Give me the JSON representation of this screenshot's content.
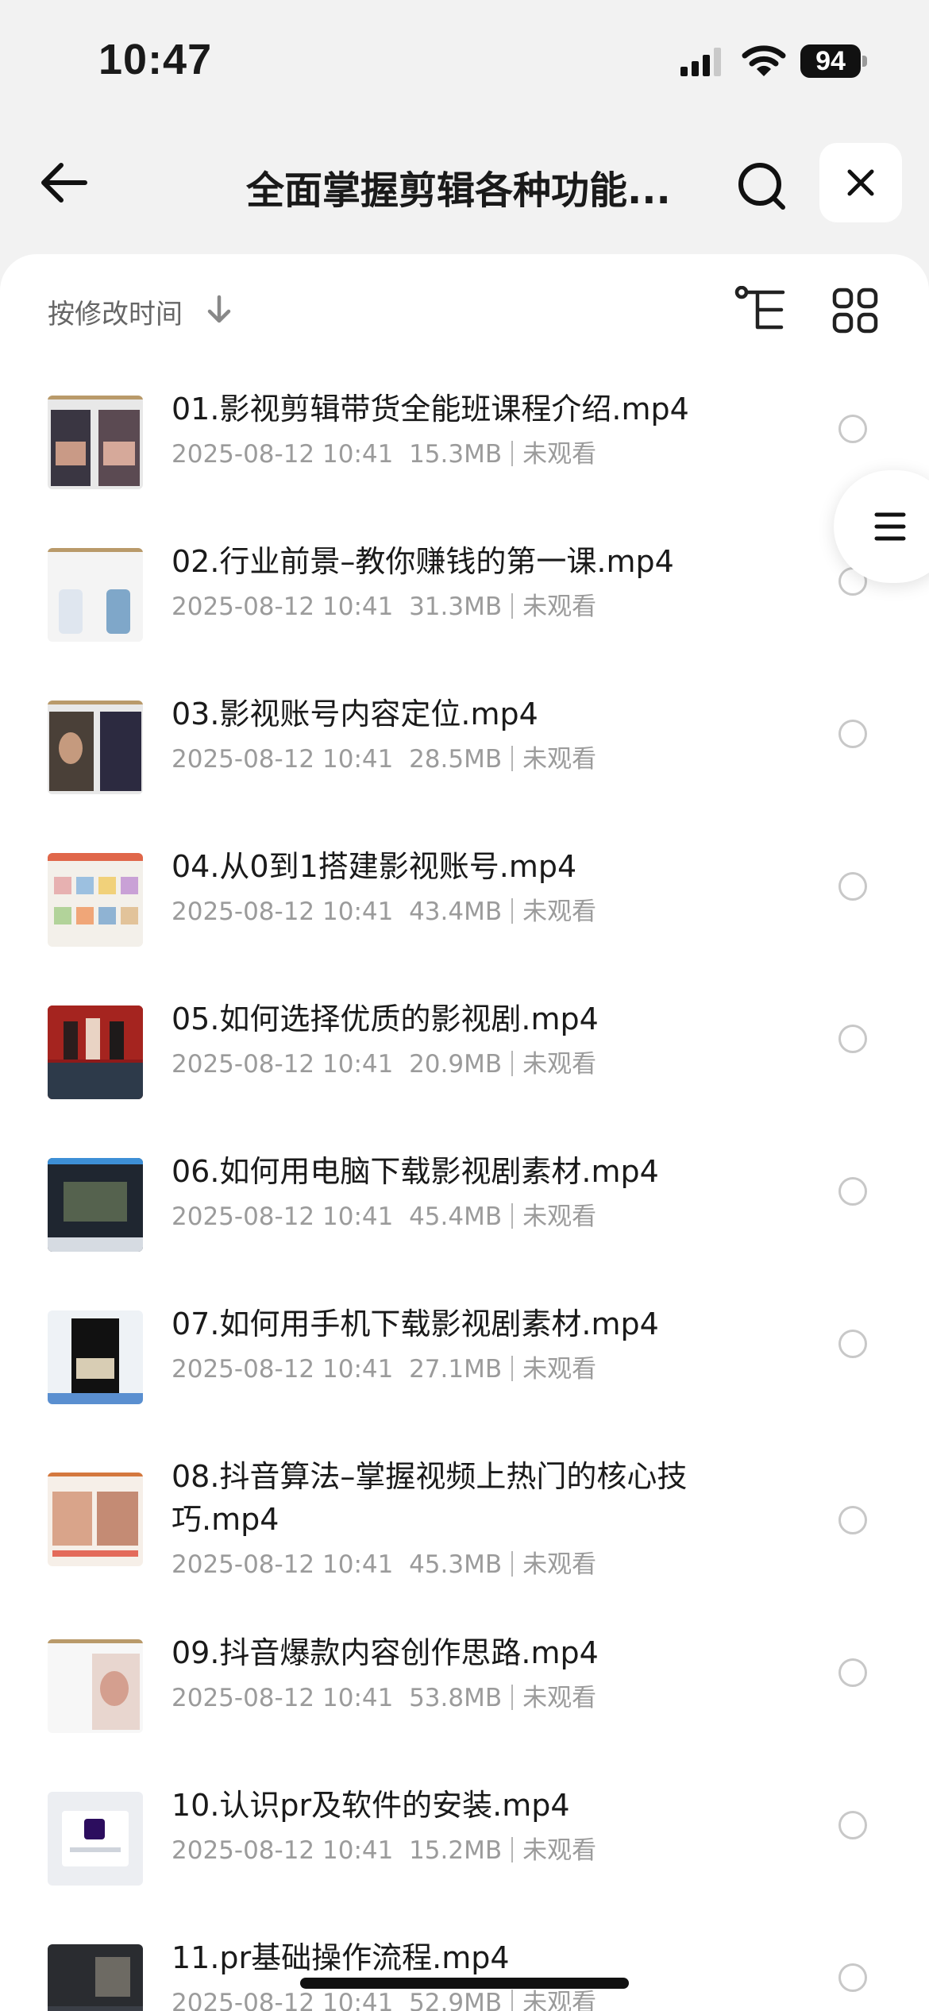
{
  "status_bar": {
    "time": "10:47",
    "battery": "94"
  },
  "nav": {
    "title": "全面掌握剪辑各种功能..."
  },
  "sort": {
    "label": "按修改时间"
  },
  "files": [
    {
      "name": "01.影视剪辑带货全能班课程介绍.mp4",
      "date": "2025-08-12 10:41",
      "size": "15.3MB",
      "status": "未观看"
    },
    {
      "name": "02.行业前景–教你赚钱的第一课.mp4",
      "date": "2025-08-12 10:41",
      "size": "31.3MB",
      "status": "未观看"
    },
    {
      "name": "03.影视账号内容定位.mp4",
      "date": "2025-08-12 10:41",
      "size": "28.5MB",
      "status": "未观看"
    },
    {
      "name": "04.从0到1搭建影视账号.mp4",
      "date": "2025-08-12 10:41",
      "size": "43.4MB",
      "status": "未观看"
    },
    {
      "name": "05.如何选择优质的影视剧.mp4",
      "date": "2025-08-12 10:41",
      "size": "20.9MB",
      "status": "未观看"
    },
    {
      "name": "06.如何用电脑下载影视剧素材.mp4",
      "date": "2025-08-12 10:41",
      "size": "45.4MB",
      "status": "未观看"
    },
    {
      "name": "07.如何用手机下载影视剧素材.mp4",
      "date": "2025-08-12 10:41",
      "size": "27.1MB",
      "status": "未观看"
    },
    {
      "name": "08.抖音算法–掌握视频上热门的核心技巧.mp4",
      "date": "2025-08-12 10:41",
      "size": "45.3MB",
      "status": "未观看"
    },
    {
      "name": "09.抖音爆款内容创作思路.mp4",
      "date": "2025-08-12 10:41",
      "size": "53.8MB",
      "status": "未观看"
    },
    {
      "name": "10.认识pr及软件的安装.mp4",
      "date": "2025-08-12 10:41",
      "size": "15.2MB",
      "status": "未观看"
    },
    {
      "name": "11.pr基础操作流程.mp4",
      "date": "2025-08-12 10:41",
      "size": "52.9MB",
      "status": "未观看"
    }
  ]
}
